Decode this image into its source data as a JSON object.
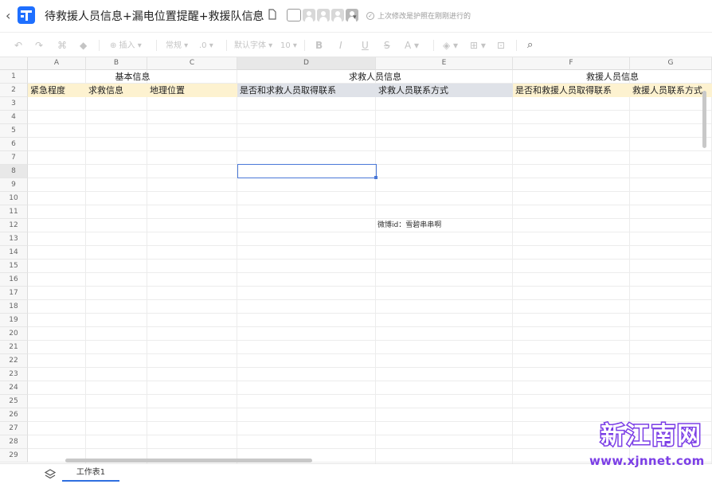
{
  "title_bar": {
    "back_glyph": "‹",
    "document_title": "待救援人员信息+漏电位置提醒+救援队信息",
    "icons": [
      "star-icon",
      "file-export-icon",
      "cloud-icon"
    ],
    "save_status": "上次修改是护照在刚刚进行的",
    "avatar_count": 4,
    "dropdown_glyph": "▾"
  },
  "toolbar": {
    "undo": "↶",
    "redo": "↷",
    "format_painter": "⌘",
    "clear": "◆",
    "insert": "⊕ 插入 ▾",
    "number_format": "常规 ▾",
    "decimal": ".0 ▾",
    "font_family": "默认字体 ▾",
    "font_size": "10 ▾",
    "bold": "B",
    "italic": "I",
    "underline": "U",
    "strikethrough": "S",
    "font_color": "A ▾",
    "fill_color": "◈ ▾",
    "borders": "⊞ ▾",
    "merge": "⊡",
    "search": "⌕"
  },
  "grid": {
    "columns": [
      "A",
      "B",
      "C",
      "D",
      "E",
      "F",
      "G"
    ],
    "active_column": "D",
    "rows": [
      "1",
      "2",
      "3",
      "4",
      "5",
      "6",
      "7",
      "8",
      "9",
      "10",
      "11",
      "12",
      "13",
      "14",
      "15",
      "16",
      "17",
      "18",
      "19",
      "20",
      "21",
      "22",
      "23",
      "24",
      "25",
      "26",
      "27",
      "28",
      "29"
    ],
    "active_row": "8",
    "merged_headers": [
      {
        "text": "基本信息",
        "span": "A1:C1"
      },
      {
        "text": "求救人员信息",
        "span": "D1:E1"
      },
      {
        "text": "救援人员信息",
        "span": "F1:G1"
      }
    ],
    "row2_headers": [
      {
        "col": "A",
        "text": "紧急程度"
      },
      {
        "col": "B",
        "text": "求救信息"
      },
      {
        "col": "C",
        "text": "地理位置"
      },
      {
        "col": "D",
        "text": "是否和求救人员取得联系"
      },
      {
        "col": "E",
        "text": "求救人员联系方式"
      },
      {
        "col": "F",
        "text": "是否和救援人员取得联系"
      },
      {
        "col": "G",
        "text": "救援人员联系方式"
      }
    ],
    "note_cell": {
      "ref": "E12",
      "text": "微博id：雪碧串串啊"
    },
    "colors": {
      "basic_band": "#fdf2d0",
      "seeker_band": "#dfe2e8",
      "rescuer_band": "#fdf2d0",
      "selection": "#4a78d8"
    }
  },
  "sheets": {
    "tabs": [
      {
        "label": "工作表1",
        "active": true
      }
    ]
  },
  "watermark": {
    "title": "新江南网",
    "url": "www.xjnnet.com"
  }
}
